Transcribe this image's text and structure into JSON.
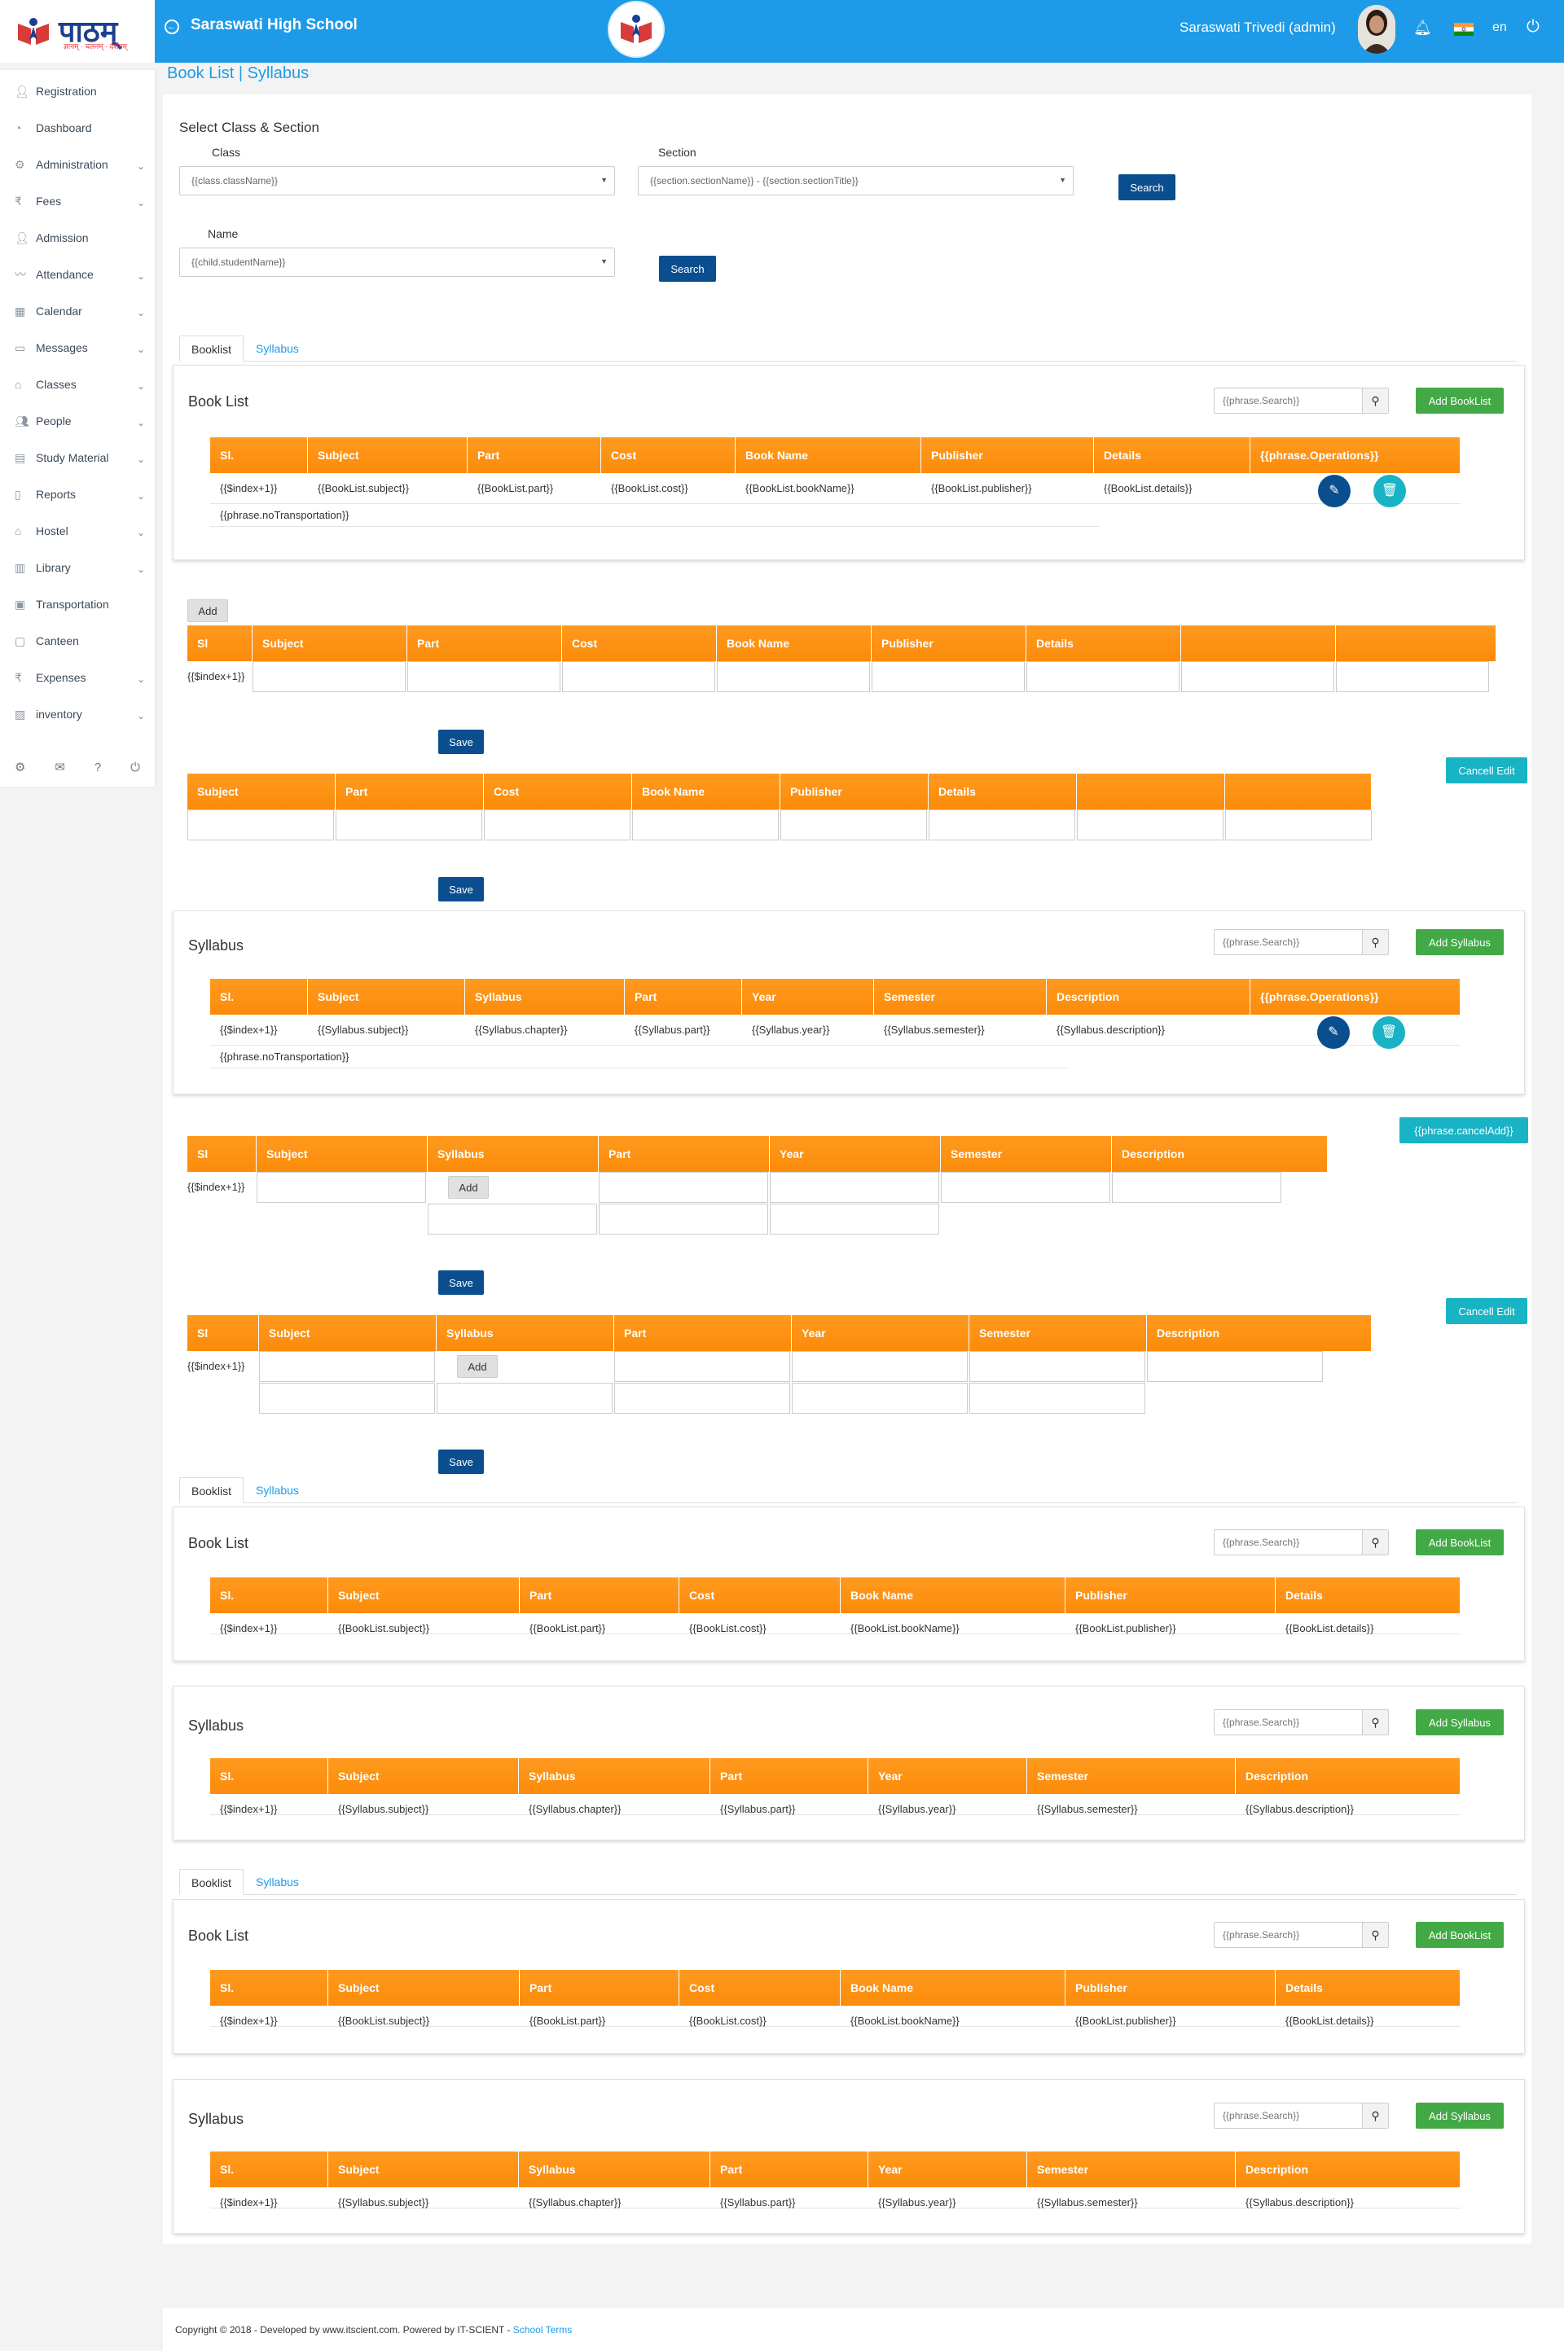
{
  "header": {
    "logo_text": "पाठम्",
    "logo_tagline": "ज्ञानम् · चलनम् · दर्शनम्",
    "school_name": "Saraswati High School",
    "user_name": "Saraswati Trivedi (admin)",
    "language": "en"
  },
  "sidebar": {
    "items": [
      {
        "label": "Registration",
        "icon": "user-plus-icon",
        "expand": false
      },
      {
        "label": "Dashboard",
        "icon": "dashboard-icon",
        "expand": false
      },
      {
        "label": "Administration",
        "icon": "gear-icon",
        "expand": true
      },
      {
        "label": "Fees",
        "icon": "rupee-icon",
        "expand": true
      },
      {
        "label": "Admission",
        "icon": "user-plus-icon",
        "expand": false
      },
      {
        "label": "Attendance",
        "icon": "chart-line-icon",
        "expand": true
      },
      {
        "label": "Calendar",
        "icon": "calendar-icon",
        "expand": true
      },
      {
        "label": "Messages",
        "icon": "message-icon",
        "expand": true
      },
      {
        "label": "Classes",
        "icon": "building-icon",
        "expand": true
      },
      {
        "label": "People",
        "icon": "people-icon",
        "expand": true
      },
      {
        "label": "Study Material",
        "icon": "book-icon",
        "expand": true
      },
      {
        "label": "Reports",
        "icon": "file-icon",
        "expand": true
      },
      {
        "label": "Hostel",
        "icon": "home-icon",
        "expand": true
      },
      {
        "label": "Library",
        "icon": "library-icon",
        "expand": true
      },
      {
        "label": "Transportation",
        "icon": "bus-icon",
        "expand": false
      },
      {
        "label": "Canteen",
        "icon": "canteen-icon",
        "expand": false
      },
      {
        "label": "Expenses",
        "icon": "rupee-icon",
        "expand": true
      },
      {
        "label": "inventory",
        "icon": "inventory-icon",
        "expand": true
      }
    ]
  },
  "breadcrumb": "Book List | Syllabus",
  "select_section": {
    "title": "Select Class & Section",
    "class_label": "Class",
    "class_value": "{{class.className}}",
    "section_label": "Section",
    "section_value": "{{section.sectionName}} - {{section.sectionTitle}}",
    "search_label": "Search",
    "name_label": "Name",
    "name_value": "{{child.studentName}}",
    "search2_label": "Search"
  },
  "tabs": {
    "booklist": "Booklist",
    "syllabus": "Syllabus"
  },
  "booklist": {
    "title": "Book List",
    "search_placeholder": "{{phrase.Search}}",
    "add_label": "Add BookList",
    "headers": [
      "Sl.",
      "Subject",
      "Part",
      "Cost",
      "Book Name",
      "Publisher",
      "Details",
      "{{phrase.Operations}}"
    ],
    "row": [
      "{{$index+1}}",
      "{{BookList.subject}}",
      "{{BookList.part}}",
      "{{BookList.cost}}",
      "{{BookList.bookName}}",
      "{{BookList.publisher}}",
      "{{BookList.details}}"
    ],
    "no_data": "{{phrase.noTransportation}}"
  },
  "add_booklist": {
    "add_label": "Add",
    "headers": [
      "Sl",
      "Subject",
      "Part",
      "Cost",
      "Book Name",
      "Publisher",
      "Details",
      "",
      ""
    ],
    "index": "{{$index+1}}",
    "save_label": "Save"
  },
  "edit_booklist": {
    "cancel_label": "Cancell Edit",
    "headers": [
      "Subject",
      "Part",
      "Cost",
      "Book Name",
      "Publisher",
      "Details",
      "",
      ""
    ],
    "save_label": "Save"
  },
  "syllabus": {
    "title": "Syllabus",
    "search_placeholder": "{{phrase.Search}}",
    "add_label": "Add Syllabus",
    "headers": [
      "Sl.",
      "Subject",
      "Syllabus",
      "Part",
      "Year",
      "Semester",
      "Description",
      "{{phrase.Operations}}"
    ],
    "row": [
      "{{$index+1}}",
      "{{Syllabus.subject}}",
      "{{Syllabus.chapter}}",
      "{{Syllabus.part}}",
      "{{Syllabus.year}}",
      "{{Syllabus.semester}}",
      "{{Syllabus.description}}"
    ],
    "no_data": "{{phrase.noTransportation}}"
  },
  "add_syllabus": {
    "cancel_label": "{{phrase.cancelAdd}}",
    "headers": [
      "Sl",
      "Subject",
      "Syllabus",
      "Part",
      "Year",
      "Semester",
      "Description"
    ],
    "index": "{{$index+1}}",
    "add_label": "Add",
    "save_label": "Save"
  },
  "edit_syllabus": {
    "cancel_label": "Cancell Edit",
    "headers": [
      "Sl",
      "Subject",
      "Syllabus",
      "Part",
      "Year",
      "Semester",
      "Description"
    ],
    "index": "{{$index+1}}",
    "add_label": "Add",
    "save_label": "Save"
  },
  "view_booklist": {
    "headers": [
      "Sl.",
      "Subject",
      "Part",
      "Cost",
      "Book Name",
      "Publisher",
      "Details"
    ],
    "row": [
      "{{$index+1}}",
      "{{BookList.subject}}",
      "{{BookList.part}}",
      "{{BookList.cost}}",
      "{{BookList.bookName}}",
      "{{BookList.publisher}}",
      "{{BookList.details}}"
    ]
  },
  "view_syllabus": {
    "headers": [
      "Sl.",
      "Subject",
      "Syllabus",
      "Part",
      "Year",
      "Semester",
      "Description"
    ],
    "row": [
      "{{$index+1}}",
      "{{Syllabus.subject}}",
      "{{Syllabus.chapter}}",
      "{{Syllabus.part}}",
      "{{Syllabus.year}}",
      "{{Syllabus.semester}}",
      "{{Syllabus.description}}"
    ]
  },
  "footer": {
    "text": "Copyright © 2018 - Developed by www.itscient.com. Powered by IT-SCIENT - ",
    "link": "School Terms"
  },
  "colors": {
    "primary": "#1e9be8",
    "table_header": "#fb8b0a",
    "dark_button": "#0a4e8f",
    "green_button": "#42a946",
    "teal_button": "#18b3c5"
  }
}
